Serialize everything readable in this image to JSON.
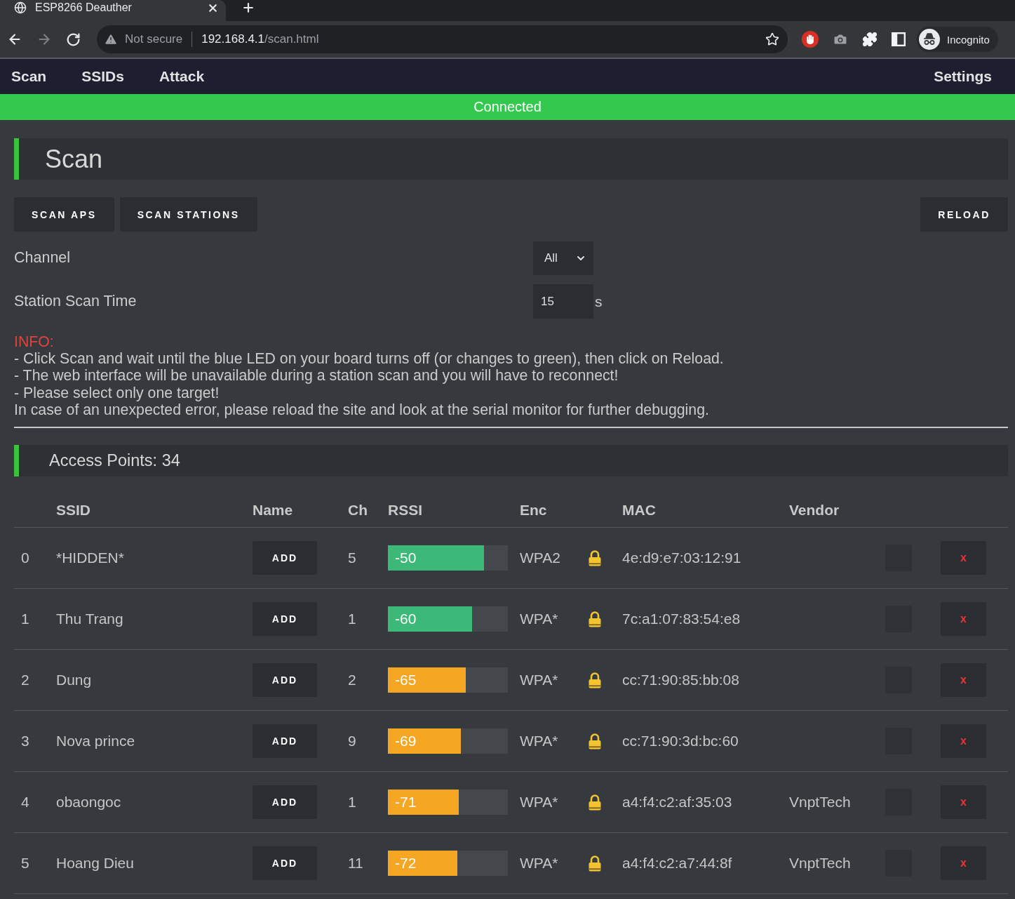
{
  "browser": {
    "tab": {
      "title": "ESP8266 Deauther"
    },
    "toolbar": {
      "security": "Not secure",
      "url": {
        "host": "192.168.4.1",
        "path": "/scan.html"
      },
      "profile": "Incognito"
    }
  },
  "nav": {
    "links": [
      "Scan",
      "SSIDs",
      "Attack"
    ],
    "settings_link": "Settings"
  },
  "status": "Connected",
  "page_title": "Scan",
  "scan_buttons": [
    "SCAN APS",
    "SCAN STATIONS"
  ],
  "reload_button": "RELOAD",
  "settings": [
    {
      "kind": "select",
      "label": "Channel",
      "value": "All"
    },
    {
      "kind": "number",
      "label": "Station Scan Time",
      "value": "15",
      "unit": "s"
    }
  ],
  "info": {
    "heading": "INFO:",
    "lines": [
      "- Click Scan and wait until the blue LED on your board turns off (or changes to green), then click on Reload.",
      "- The web interface will be unavailable during a station scan and you will have to reconnect!",
      "- Please select only one target!",
      "In case of an unexpected error, please reload the site and look at the serial monitor for further debugging."
    ]
  },
  "access_points": {
    "heading": "Access Points: 34",
    "table": {
      "columns": [
        "SSID",
        "Name",
        "Ch",
        "RSSI",
        "Enc",
        "MAC",
        "Vendor"
      ],
      "rows": [
        {
          "index": "0",
          "ssid": "*HIDDEN*",
          "name_button": "ADD",
          "ch": "5",
          "rssi": "-50",
          "level": 0.8,
          "color": "#3cb878",
          "enc": "WPA2",
          "mac": "4e:d9:e7:03:12:91",
          "checked": false,
          "delete_button": "x"
        },
        {
          "index": "1",
          "ssid": "Thu Trang",
          "name_button": "ADD",
          "ch": "1",
          "rssi": "-60",
          "level": 0.7,
          "color": "#3cb878",
          "enc": "WPA*",
          "mac": "7c:a1:07:83:54:e8",
          "checked": false,
          "delete_button": "x"
        },
        {
          "index": "2",
          "ssid": "Dung",
          "name_button": "ADD",
          "ch": "2",
          "rssi": "-65",
          "level": 0.65,
          "color": "#f5a623",
          "enc": "WPA*",
          "mac": "cc:71:90:85:bb:08",
          "checked": false,
          "delete_button": "x"
        },
        {
          "index": "3",
          "ssid": "Nova prince",
          "name_button": "ADD",
          "ch": "9",
          "rssi": "-69",
          "level": 0.61,
          "color": "#f5a623",
          "enc": "WPA*",
          "mac": "cc:71:90:3d:bc:60",
          "checked": false,
          "delete_button": "x"
        },
        {
          "index": "4",
          "ssid": "obaongoc",
          "name_button": "ADD",
          "ch": "1",
          "rssi": "-71",
          "level": 0.59,
          "color": "#f5a623",
          "enc": "WPA*",
          "mac": "a4:f4:c2:af:35:03",
          "vendor": "VnptTech",
          "checked": false,
          "delete_button": "x"
        },
        {
          "index": "5",
          "ssid": "Hoang Dieu",
          "name_button": "ADD",
          "ch": "11",
          "rssi": "-72",
          "level": 0.58,
          "color": "#f5a623",
          "enc": "WPA*",
          "mac": "a4:f4:c2:a7:44:8f",
          "vendor": "VnptTech",
          "checked": false,
          "delete_button": "x"
        }
      ]
    }
  }
}
